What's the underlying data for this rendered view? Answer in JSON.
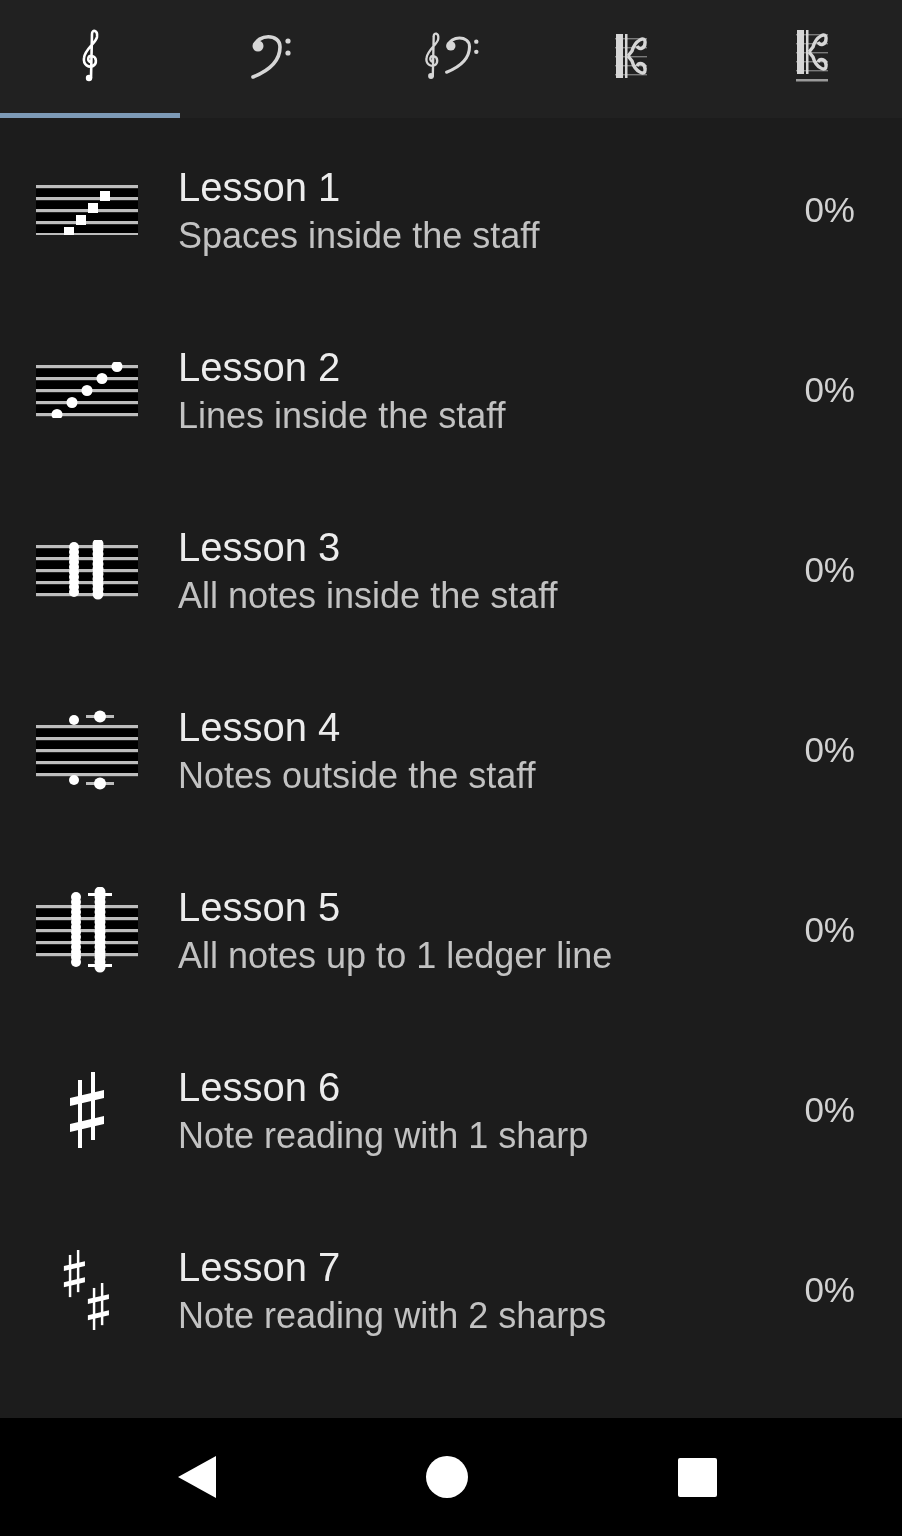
{
  "tabs": [
    {
      "kind": "treble",
      "selected": true
    },
    {
      "kind": "bass",
      "selected": false
    },
    {
      "kind": "grand",
      "selected": false
    },
    {
      "kind": "cclef",
      "selected": false
    },
    {
      "kind": "cclefraised",
      "selected": false
    }
  ],
  "lessons": [
    {
      "kind": "spaces",
      "title": "Lesson 1",
      "description": "Spaces inside the staff",
      "progress": "0%"
    },
    {
      "kind": "lines",
      "title": "Lesson 2",
      "description": "Lines inside the staff",
      "progress": "0%"
    },
    {
      "kind": "chords",
      "title": "Lesson 3",
      "description": "All notes inside the staff",
      "progress": "0%"
    },
    {
      "kind": "ledger",
      "title": "Lesson 4",
      "description": "Notes outside the staff",
      "progress": "0%"
    },
    {
      "kind": "chordsledger",
      "title": "Lesson 5",
      "description": "All notes up to 1 ledger line",
      "progress": "0%"
    },
    {
      "kind": "sharp",
      "title": "Lesson 6",
      "description": "Note reading with 1 sharp",
      "progress": "0%"
    },
    {
      "kind": "twosharps",
      "title": "Lesson 7",
      "description": "Note reading with 2 sharps",
      "progress": "0%"
    }
  ]
}
